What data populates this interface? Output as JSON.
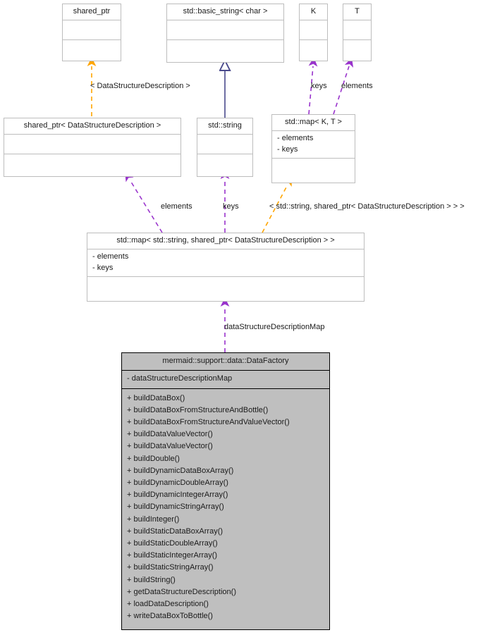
{
  "diagram": {
    "type": "uml-class-collaboration-diagram",
    "colors": {
      "background": "#ffffff",
      "box_border": "#bdbdbd",
      "box_fill": "#ffffff",
      "highlight_border": "#000000",
      "highlight_fill": "#bfbfbf",
      "usage_arrow": "#9933cc",
      "template_arrow": "#ffa500",
      "inheritance_arrow": "#4a4a8c",
      "text": "#1a1a1a"
    },
    "nodes": [
      {
        "id": "shared_ptr",
        "title": "shared_ptr",
        "attributes": [],
        "operations": [],
        "highlight": false
      },
      {
        "id": "basic_string",
        "title": "std::basic_string< char >",
        "attributes": [],
        "operations": [],
        "highlight": false
      },
      {
        "id": "k",
        "title": "K",
        "attributes": [],
        "operations": [],
        "highlight": false
      },
      {
        "id": "t",
        "title": "T",
        "attributes": [],
        "operations": [],
        "highlight": false
      },
      {
        "id": "shared_ptr_dsd",
        "title": "shared_ptr< DataStructureDescription >",
        "attributes": [],
        "operations": [],
        "highlight": false
      },
      {
        "id": "std_string",
        "title": "std::string",
        "attributes": [],
        "operations": [],
        "highlight": false
      },
      {
        "id": "std_map_kt",
        "title": "std::map< K, T >",
        "attributes": [
          "- elements",
          "- keys"
        ],
        "operations": [],
        "highlight": false
      },
      {
        "id": "std_map_string_ptr",
        "title": "std::map< std::string, shared_ptr< DataStructureDescription > >",
        "attributes": [
          "- elements",
          "- keys"
        ],
        "operations": [],
        "highlight": false
      },
      {
        "id": "data_factory",
        "title": "mermaid::support::data::DataFactory",
        "attributes": [
          "- dataStructureDescriptionMap"
        ],
        "operations": [
          "+ buildDataBox()",
          "+ buildDataBoxFromStructureAndBottle()",
          "+ buildDataBoxFromStructureAndValueVector()",
          "+ buildDataValueVector()",
          "+ buildDataValueVector()",
          "+ buildDouble()",
          "+ buildDynamicDataBoxArray()",
          "+ buildDynamicDoubleArray()",
          "+ buildDynamicIntegerArray()",
          "+ buildDynamicStringArray()",
          "+ buildInteger()",
          "+ buildStaticDataBoxArray()",
          "+ buildStaticDoubleArray()",
          "+ buildStaticIntegerArray()",
          "+ buildStaticStringArray()",
          "+ buildString()",
          "+ getDataStructureDescription()",
          "+ loadDataDescription()",
          "+ writeDataBoxToBottle()"
        ],
        "highlight": true
      }
    ],
    "edge_labels": [
      {
        "id": "tmpl_dsd",
        "text": "< DataStructureDescription >"
      },
      {
        "id": "keys_kt",
        "text": "keys"
      },
      {
        "id": "elements_kt",
        "text": "elements"
      },
      {
        "id": "elements_map",
        "text": "elements"
      },
      {
        "id": "keys_map",
        "text": "keys"
      },
      {
        "id": "tmpl_map",
        "text": "< std::string, shared_ptr< DataStructureDescription > > >"
      },
      {
        "id": "dsd_map_field",
        "text": "dataStructureDescriptionMap"
      }
    ]
  }
}
